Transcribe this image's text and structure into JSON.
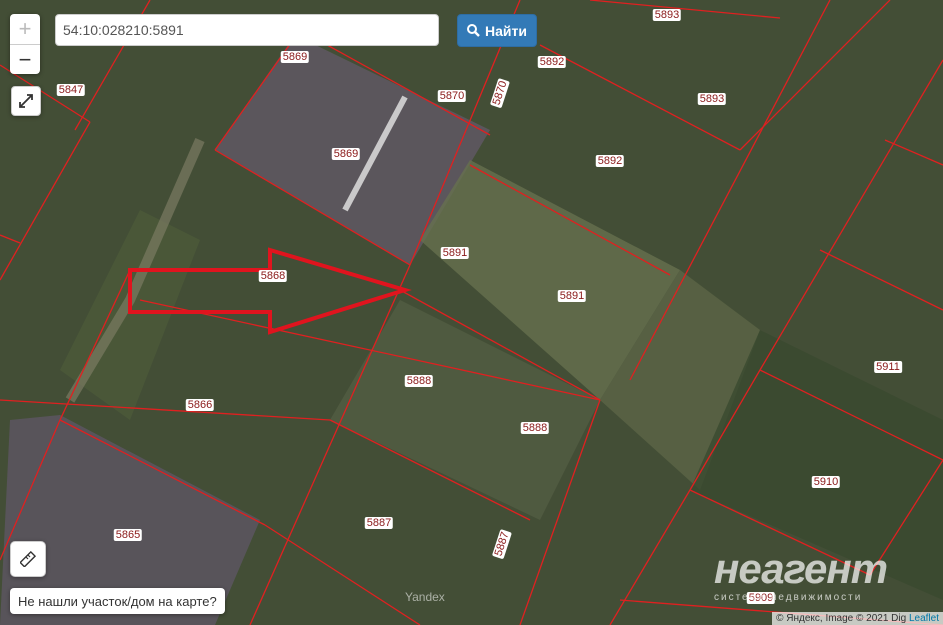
{
  "search": {
    "value": "54:10:028210:5891",
    "button_label": "Найти"
  },
  "zoom": {
    "in_label": "+",
    "out_label": "−"
  },
  "not_found_label": "Не нашли участок/дом на карте?",
  "attribution": {
    "yandex": "© Яндекс, Image © 2021 Dig",
    "leaflet": "Leaflet"
  },
  "provider_mark": "Yandex",
  "watermark": {
    "main": "неагент",
    "sub": "система недвижимости"
  },
  "parcel_labels": [
    "5847",
    "5869",
    "5870",
    "5870",
    "5892",
    "5893",
    "5893",
    "5869",
    "5892",
    "5891",
    "5868",
    "5891",
    "5888",
    "5866",
    "5888",
    "5911",
    "5910",
    "5865",
    "5887",
    "5887",
    "5909"
  ],
  "colors": {
    "boundary": "#e02020",
    "arrow": "#e0141e",
    "button": "#337ab7",
    "label_text": "#8b1a1a"
  },
  "icons": [
    "search-icon",
    "expand-icon",
    "ruler-icon"
  ]
}
